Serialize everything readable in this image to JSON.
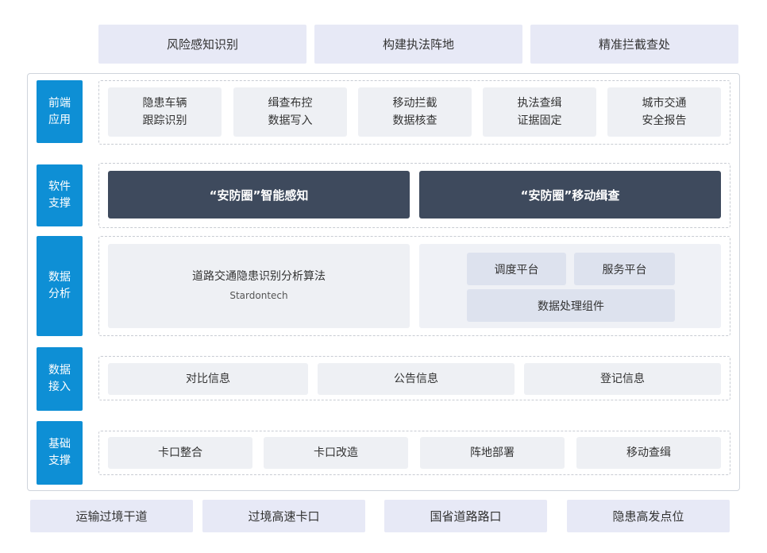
{
  "top_banner": [
    "风险感知识别",
    "构建执法阵地",
    "精准拦截查处"
  ],
  "layers": {
    "frontend": {
      "label": "前端\n应用",
      "items": [
        "隐患车辆\n跟踪识别",
        "缉查布控\n数据写入",
        "移动拦截\n数据核查",
        "执法查缉\n证据固定",
        "城市交通\n安全报告"
      ]
    },
    "software": {
      "label": "软件\n支撑",
      "items": [
        "“安防圈”智能感知",
        "“安防圈”移动缉查"
      ]
    },
    "analysis": {
      "label": "数据\n分析",
      "algorithm_title": "道路交通隐患识别分析算法",
      "algorithm_sub": "Stardontech",
      "platform": {
        "dispatch": "调度平台",
        "service": "服务平台",
        "processing": "数据处理组件"
      }
    },
    "access": {
      "label": "数据\n接入",
      "items": [
        "对比信息",
        "公告信息",
        "登记信息"
      ]
    },
    "base": {
      "label": "基础\n支撑",
      "items": [
        "卡口整合",
        "卡口改造",
        "阵地部署",
        "移动查缉"
      ]
    }
  },
  "bottom_banner": [
    "运输过境干道",
    "过境高速卡口",
    "国省道路路口",
    "隐患高发点位"
  ],
  "colors": {
    "label_blue": "#0e8fd5",
    "dark_slate": "#3e4a5d",
    "banner_lavender": "#e7e9f6",
    "cell_gray": "#eef0f4"
  }
}
